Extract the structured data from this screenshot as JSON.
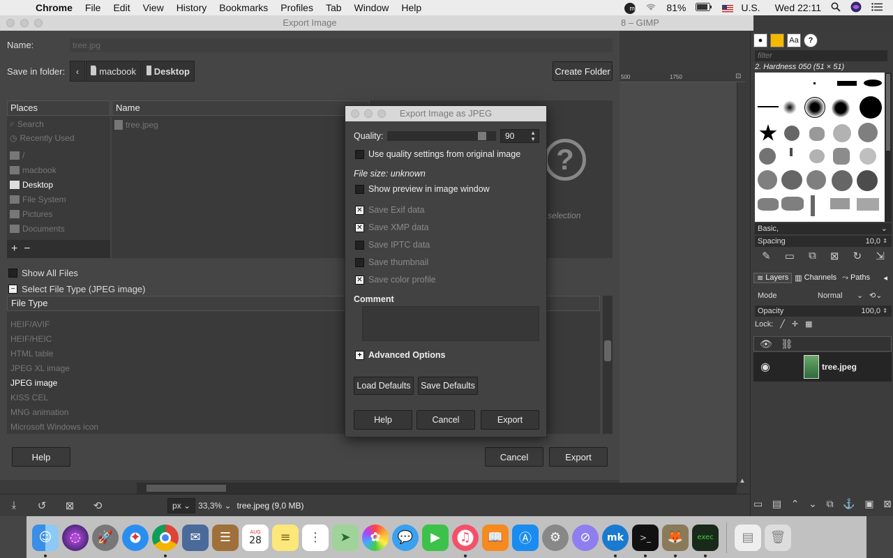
{
  "menubar": {
    "app": "Chrome",
    "items": [
      "File",
      "Edit",
      "View",
      "History",
      "Bookmarks",
      "Profiles",
      "Tab",
      "Window",
      "Help"
    ],
    "mk": "mk",
    "battery": "81%",
    "input_source": "U.S.",
    "clock": "Wed 22:11"
  },
  "gimp": {
    "title_fragment": "8 – GIMP",
    "ruler": [
      "500",
      "1750"
    ],
    "status": {
      "unit": "px",
      "zoom": "33,3%",
      "file": "tree.jpeg (9,0 MB)"
    }
  },
  "dock_panel": {
    "filter_placeholder": "filter",
    "brush_name": "2. Hardness 050 (51 × 51)",
    "preset": "Basic,",
    "spacing_label": "Spacing",
    "spacing_value": "10,0",
    "tabs": [
      "Layers",
      "Channels",
      "Paths"
    ],
    "mode_label": "Mode",
    "mode_value": "Normal",
    "opacity_label": "Opacity",
    "opacity_value": "100,0",
    "lock_label": "Lock:",
    "layer_name": "tree.jpeg"
  },
  "export_dialog": {
    "title": "Export Image",
    "name_label": "Name:",
    "name_value": "tree.jpg",
    "folder_label": "Save in folder:",
    "path": [
      "macbook",
      "Desktop"
    ],
    "create_folder": "Create Folder",
    "places_header": "Places",
    "places": [
      "Search",
      "Recently Used",
      "/",
      "macbook",
      "Desktop",
      "File System",
      "Pictures",
      "Documents"
    ],
    "places_active": "Desktop",
    "name_header": "Name",
    "files": [
      "tree.jpeg"
    ],
    "preview_text": "selection",
    "show_all_files": "Show All Files",
    "select_file_type": "Select File Type (JPEG image)",
    "file_type_header": "File Type",
    "file_types": [
      "HEIF/AVIF",
      "HEIF/HEIC",
      "HTML table",
      "JPEG XL image",
      "JPEG image",
      "KISS CEL",
      "MNG animation",
      "Microsoft Windows icon"
    ],
    "file_type_active": "JPEG image",
    "help": "Help",
    "cancel": "Cancel",
    "export": "Export"
  },
  "jpeg_dialog": {
    "title": "Export Image as JPEG",
    "quality_label": "Quality:",
    "quality_value": "90",
    "quality": 0.9,
    "use_original": "Use quality settings from original image",
    "file_size": "File size: unknown",
    "show_preview": "Show preview in image window",
    "options": [
      {
        "label": "Save Exif data",
        "checked": true
      },
      {
        "label": "Save XMP data",
        "checked": true
      },
      {
        "label": "Save IPTC data",
        "checked": false
      },
      {
        "label": "Save thumbnail",
        "checked": false
      },
      {
        "label": "Save color profile",
        "checked": true
      }
    ],
    "comment_label": "Comment",
    "advanced": "Advanced Options",
    "load_defaults": "Load Defaults",
    "save_defaults": "Save Defaults",
    "help": "Help",
    "cancel": "Cancel",
    "export": "Export"
  },
  "macdock": {
    "calendar_month": "AUG",
    "calendar_day": "28"
  }
}
